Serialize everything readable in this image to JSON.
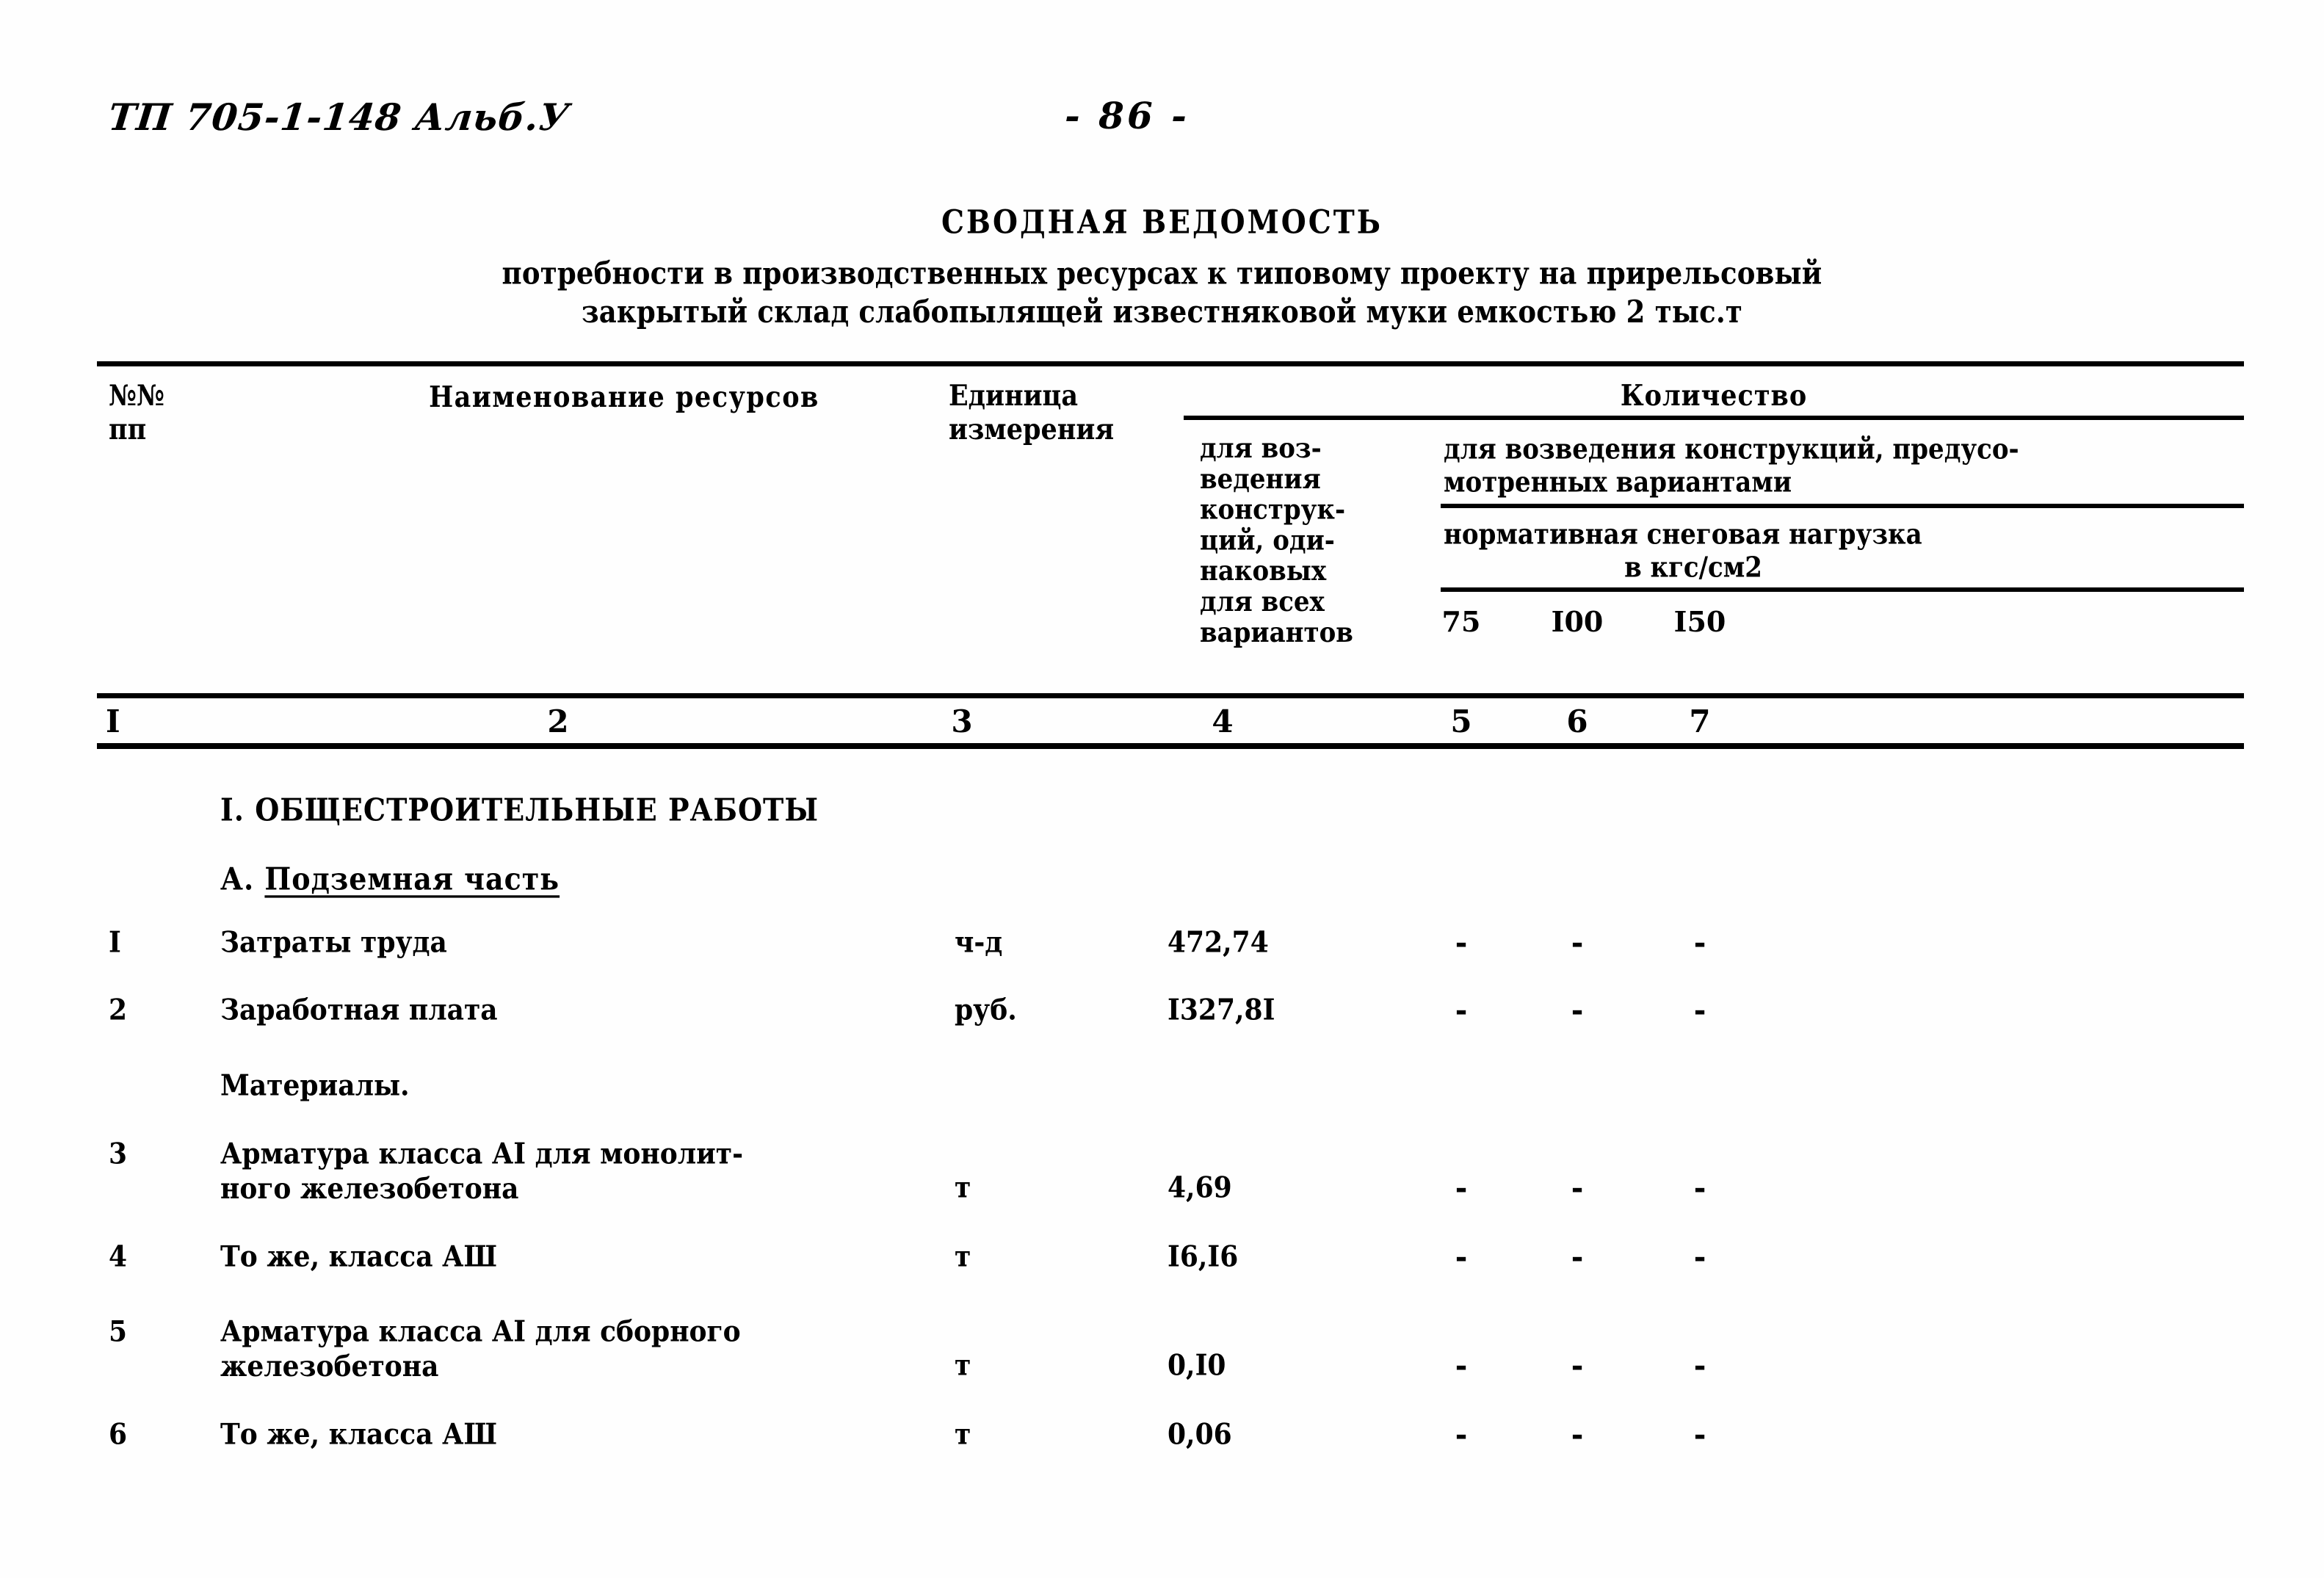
{
  "header": {
    "doc_code": "ТП 705-1-148   Альб.У",
    "page_number": "-  86  -"
  },
  "title": {
    "main": "СВОДНАЯ ВЕДОМОСТЬ",
    "sub_line1": "потребности в производственных ресурсах к типовому проекту на прирельсовый",
    "sub_line2": "закрытый склад слабопылящей известняковой муки емкостью 2 тыс.т"
  },
  "table_header": {
    "col_no_line1": "№№",
    "col_no_line2": "пп",
    "col_name": "Наименование ресурсов",
    "col_unit_line1": "Единица",
    "col_unit_line2": "измерения",
    "col_quantity": "Количество",
    "col4_lines": [
      "для воз-",
      "ведения",
      "конструк-",
      "ций, оди-",
      "наковых",
      "для всех",
      "вариантов"
    ],
    "variants_line1": "для возведения конструкций, предусо-",
    "variants_line2": "мотренных вариантами",
    "snow_line1": "нормативная снеговая нагрузка",
    "snow_line2": "в кгс/см2",
    "snow_cols": [
      "75",
      "I00",
      "I50"
    ]
  },
  "column_numbers": [
    "I",
    "2",
    "3",
    "4",
    "5",
    "6",
    "7"
  ],
  "sections": {
    "section_1": "I. ОБЩЕСТРОИТЕЛЬНЫЕ РАБОТЫ",
    "section_a_prefix": "А. ",
    "section_a_title": "Подземная часть",
    "materials_label": "Материалы."
  },
  "rows": [
    {
      "no": "I",
      "name_line1": "Затраты труда",
      "name_line2": "",
      "unit": "ч-д",
      "qty": "472,74",
      "v75": "-",
      "v100": "-",
      "v150": "-"
    },
    {
      "no": "2",
      "name_line1": "Заработная плата",
      "name_line2": "",
      "unit": "руб.",
      "qty": "I327,8I",
      "v75": "-",
      "v100": "-",
      "v150": "-"
    },
    {
      "no": "3",
      "name_line1": "Арматура класса АI для монолит-",
      "name_line2": "ного железобетона",
      "unit": "т",
      "qty": "4,69",
      "v75": "-",
      "v100": "-",
      "v150": "-"
    },
    {
      "no": "4",
      "name_line1": "То же, класса АШ",
      "name_line2": "",
      "unit": "т",
      "qty": "I6,I6",
      "v75": "-",
      "v100": "-",
      "v150": "-"
    },
    {
      "no": "5",
      "name_line1": "Арматура класса АI для сборного",
      "name_line2": "железобетона",
      "unit": "т",
      "qty": "0,I0",
      "v75": "-",
      "v100": "-",
      "v150": "-"
    },
    {
      "no": "6",
      "name_line1": "То же, класса АШ",
      "name_line2": "",
      "unit": "т",
      "qty": "0,06",
      "v75": "-",
      "v100": "-",
      "v150": "-"
    }
  ]
}
